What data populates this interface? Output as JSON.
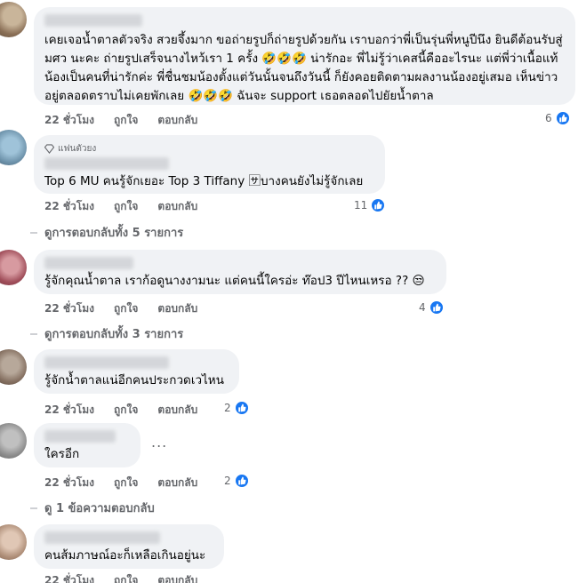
{
  "comments": [
    {
      "text": "เคยเจอน้ำตาลตัวจริง สวยจึ้งมาก ขอถ่ายรูปก็ถ่ายรูปด้วยกัน เราบอกว่าพี่เป็นรุ่นพี่หนูปีนึง ยินดีต้อนรับสู่ มศว นะคะ ถ่ายรูปเสร็จนางไหว้เรา 1 ครั้ง 🤣🤣🤣 น่ารักอะ พี่ไม่รู้ว่าเคสนี้คืออะไรนะ แต่พี่ว่าเนื้อแท้น้องเป็นคนที่น่ารักค่ะ พี่ชื่นชมน้องตั้งแต่วันนั้นจนถึงวันนี้ ก็ยังคอยติดตามผลงานน้องอยู่เสมอ เห็นข่าวอยู่ตลอดตราบไม่เคยพักเลย 🤣🤣🤣 ฉันจะ support เธอตลอดไปยัยน้ำตาล",
      "time": "22 ชั่วโมง",
      "like": "ถูกใจ",
      "reply": "ตอบกลับ",
      "likes": "6"
    },
    {
      "badge": "แฟนตัวยง",
      "text": "Top 6 MU คนรู้จักเยอะ Top 3 Tiffany 🈂บางคนยังไม่รู้จักเลย",
      "time": "22 ชั่วโมง",
      "like": "ถูกใจ",
      "reply": "ตอบกลับ",
      "likes": "11"
    },
    {
      "text": "รู้จักคุณน้ำตาล เราก้อดูนางงามนะ แต่คนนี้ใครอ่ะ ท๊อป3 ปีไหนเหรอ ?? 😒",
      "time": "22 ชั่วโมง",
      "like": "ถูกใจ",
      "reply": "ตอบกลับ",
      "likes": "4"
    },
    {
      "text": "รู้จักน้ำตาลแน่อีกคนประกวดเวไหน",
      "time": "22 ชั่วโมง",
      "like": "ถูกใจ",
      "reply": "ตอบกลับ",
      "likes": "2"
    },
    {
      "text": "ใครอีก",
      "time": "22 ชั่วโมง",
      "like": "ถูกใจ",
      "reply": "ตอบกลับ",
      "likes": "2",
      "more": "..."
    },
    {
      "text": "คนส้มภาษณ์อะก็เหลือเกินอยู่นะ",
      "time": "22 ชั่วโมง",
      "like": "ถูกใจ",
      "reply": "ตอบกลับ"
    }
  ],
  "view_replies": [
    "ดูการตอบกลับทั้ง 5 รายการ",
    "ดูการตอบกลับทั้ง 3 รายการ",
    "ดู 1 ข้อความตอบกลับ"
  ]
}
